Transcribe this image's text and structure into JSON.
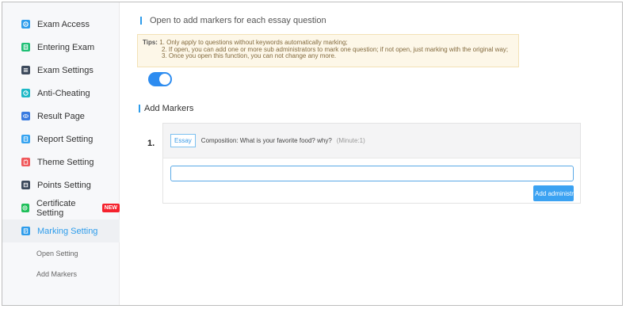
{
  "sidebar": {
    "items": [
      {
        "label": "Exam Access",
        "icon": "exam-access-icon",
        "color": "#2d9ceb"
      },
      {
        "label": "Entering Exam",
        "icon": "entering-exam-icon",
        "color": "#1fbf75"
      },
      {
        "label": "Exam Settings",
        "icon": "exam-settings-icon",
        "color": "#3d4a5c"
      },
      {
        "label": "Anti-Cheating",
        "icon": "anti-cheating-icon",
        "color": "#1cb8c6"
      },
      {
        "label": "Result Page",
        "icon": "result-page-icon",
        "color": "#3a7be0"
      },
      {
        "label": "Report Setting",
        "icon": "report-setting-icon",
        "color": "#36a3f0"
      },
      {
        "label": "Theme Setting",
        "icon": "theme-setting-icon",
        "color": "#f0585b"
      },
      {
        "label": "Points Setting",
        "icon": "points-setting-icon",
        "color": "#3d4a5c"
      },
      {
        "label": "Certificate Setting",
        "icon": "certificate-setting-icon",
        "color": "#1fbf5a",
        "badge": "NEW"
      },
      {
        "label": "Marking Setting",
        "icon": "marking-setting-icon",
        "color": "#2d9ceb",
        "active": true
      }
    ],
    "sub_items": [
      {
        "label": "Open Setting"
      },
      {
        "label": "Add Markers"
      }
    ]
  },
  "main": {
    "open_section": {
      "title": "Open to add markers for each essay question"
    },
    "tips": {
      "label": "Tips:",
      "lines": [
        "1. Only apply to questions without keywords automatically marking;",
        "2. If open, you can add one or more sub administrators to mark one question; if not open, just marking with the original way;",
        "3. Once you open this function, you can not change any more."
      ]
    },
    "toggle": {
      "state": "on",
      "color": "#2d8cf0"
    },
    "add_markers_section": {
      "title": "Add Markers"
    },
    "question": {
      "number": "1.",
      "tag": "Essay",
      "text": "Composition: What is your favorite food? why?",
      "minute": "(Minute:1)",
      "input_value": "",
      "add_button_label": "Add administr"
    }
  },
  "colors": {
    "accent": "#2d9ceb",
    "tips_bg": "#fdf7e8",
    "badge_red": "#f5222d"
  }
}
